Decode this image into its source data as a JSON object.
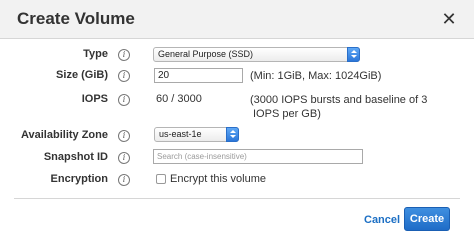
{
  "dialog": {
    "title": "Create Volume",
    "close_glyph": "✕"
  },
  "fields": {
    "type": {
      "label": "Type",
      "value": "General Purpose (SSD)"
    },
    "size": {
      "label": "Size (GiB)",
      "value": "20",
      "hint": "(Min: 1GiB, Max: 1024GiB)"
    },
    "iops": {
      "label": "IOPS",
      "value": "60 / 3000",
      "hint_line1": "(3000 IOPS bursts and baseline of 3",
      "hint_line2": "IOPS per GB)"
    },
    "availability_zone": {
      "label": "Availability Zone",
      "value": "us-east-1e"
    },
    "snapshot_id": {
      "label": "Snapshot ID",
      "placeholder": "Search (case-insensitive)"
    },
    "encryption": {
      "label": "Encryption",
      "checkbox_label": "Encrypt this volume",
      "checked": false
    }
  },
  "info_glyph": "i",
  "footer": {
    "cancel_label": "Cancel",
    "create_label": "Create"
  }
}
